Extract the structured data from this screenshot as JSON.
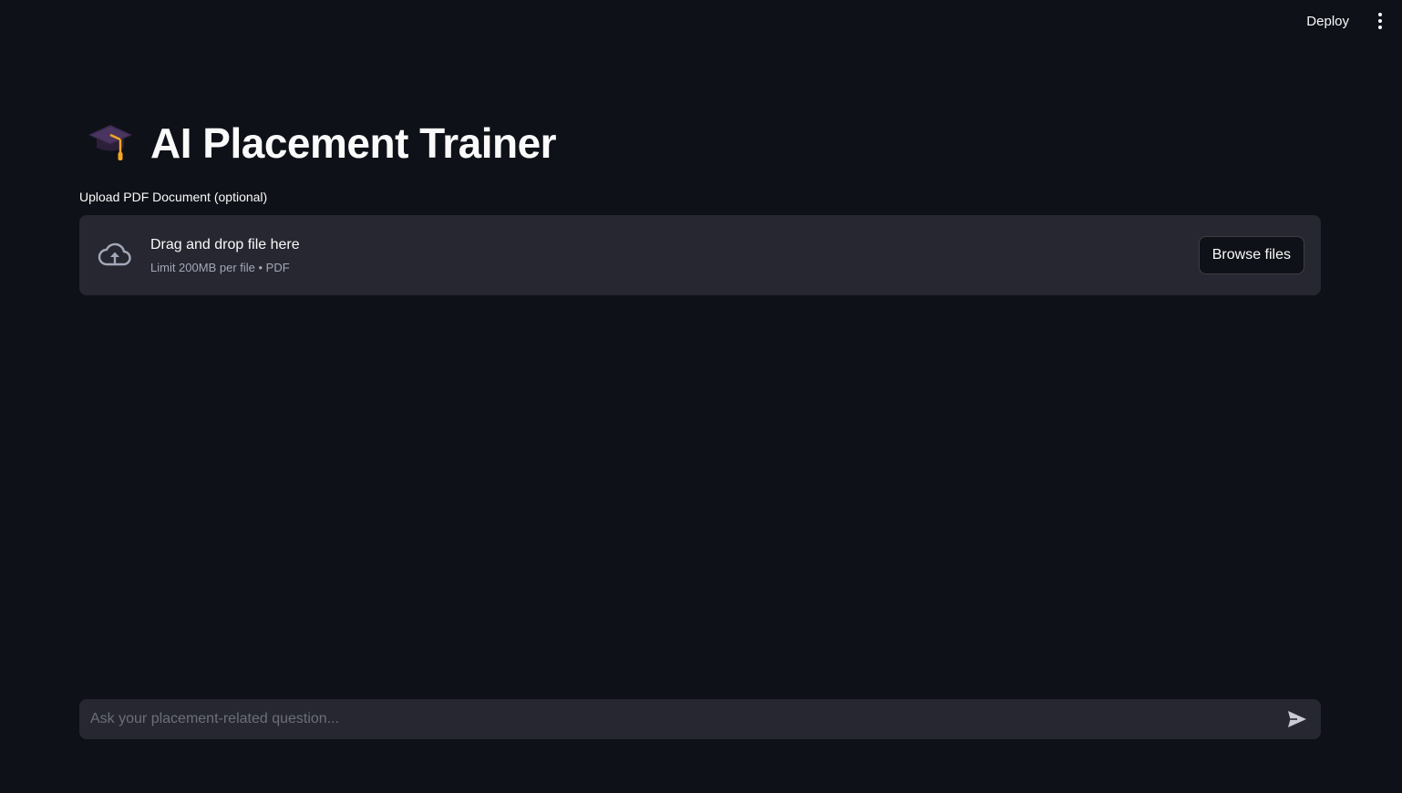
{
  "header": {
    "deploy_label": "Deploy",
    "menu_icon": "kebab-menu-icon"
  },
  "main": {
    "title": "AI Placement Trainer",
    "title_icon": "graduation-cap-icon",
    "uploader": {
      "label": "Upload PDF Document (optional)",
      "icon": "cloud-upload-icon",
      "drop_text": "Drag and drop file here",
      "limit_text": "Limit 200MB per file • PDF",
      "browse_label": "Browse files"
    }
  },
  "chat": {
    "placeholder": "Ask your placement-related question...",
    "send_icon": "send-icon"
  },
  "colors": {
    "background": "#0e1117",
    "surface": "#262730",
    "text": "#fafafa",
    "muted": "#a3a8b8",
    "accent_cap": "#f5a623"
  }
}
